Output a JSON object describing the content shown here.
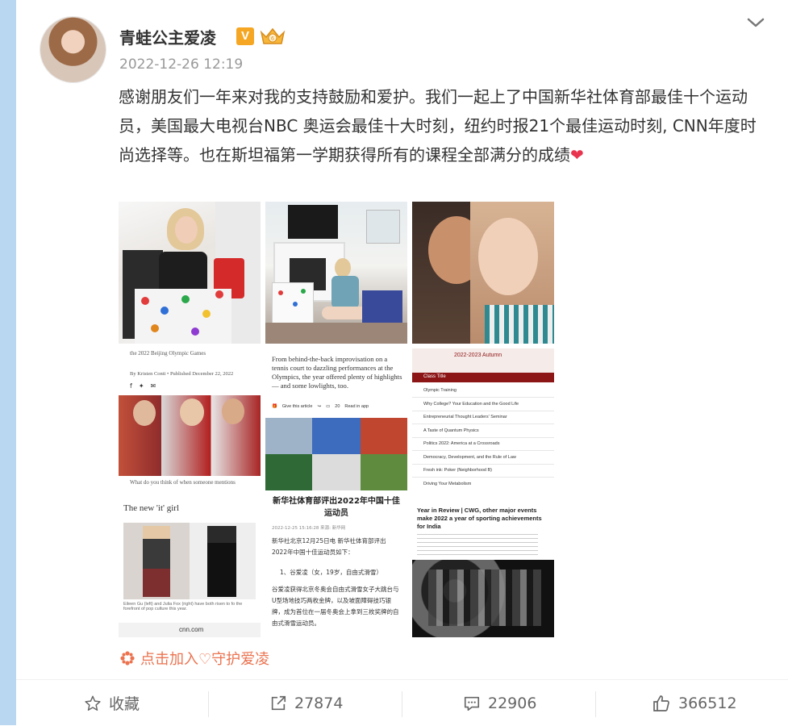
{
  "post": {
    "username": "青蛙公主爱凌",
    "verified_badge": "V",
    "timestamp": "2022-12-26 12:19",
    "text": "感谢朋友们一年来对我的支持鼓励和爱护。我们一起上了中国新华社体育部最佳十个运动员，美国最大电视台NBC 奥运会最佳十大时刻，纽约时报21个最佳运动时刻, CNN年度时尚选择等。也在斯坦福第一学期获得所有的课程全部满分的成绩",
    "heart": "❤"
  },
  "images": {
    "img4_text1": "the 2022 Beijing Olympic Games",
    "img4_byline": "By Kristen Conti • Published December 22, 2022",
    "img4_question": "What do you think of when someone mentions",
    "img5_headline": "From behind-the-back improvisation on a tennis court to dazzling performances at the Olympics, the year offered plenty of highlights — and some lowlights, too.",
    "img5_share": "Give this article",
    "img5_comments": "20",
    "img5_read": "Read in app",
    "img6_title": "2022-2023 Autumn",
    "img6_col1": "Class Title",
    "img6_rows": [
      "Olympic Training",
      "Why College? Your Education and the Good Life",
      "Entrepreneurial Thought Leaders' Seminar",
      "A Taste of Quantum Physics",
      "Politics 2022: America at a Crossroads",
      "Democracy, Development, and the Rule of Law",
      "Fresh ink: Poker (Neighborhood B)",
      "Driving Your Metabolism"
    ],
    "img7_heading": "The new 'it' girl",
    "img7_caption": "Eileen Gu (left) and Julia Fox (right) have both risen to fo the forefront of pop culture this year.",
    "img7_url": "cnn.com",
    "img8_title": "新华社体育部评出2022年中国十佳运动员",
    "img8_meta": "2022-12-25 15:16:28 来源: 新华网",
    "img8_p1": "新华社北京12月25日电 新华社体育部评出2022年中国十佳运动员如下：",
    "img8_p2": "1、谷爱凌（女，19岁，自由式滑雪）",
    "img8_p3": "谷爱凌获得北京冬奥会自由式滑雪女子大跳台与U型场地技巧两枚金牌，以及坡面障碍技巧银牌，成为首位在一届冬奥会上拿到三枚奖牌的自由式滑雪运动员。",
    "img9_title": "Year in Review | CWG, other major events make 2022 a year of sporting achievements for India"
  },
  "join": {
    "label": "点击加入♡守护爱凌"
  },
  "actions": {
    "favorite_label": "收藏",
    "repost_count": "27874",
    "comment_count": "22906",
    "like_count": "366512"
  },
  "colors": {
    "link_orange": "#eb7350",
    "heart_red": "#e8344e",
    "badge_gold": "#f5a623"
  }
}
